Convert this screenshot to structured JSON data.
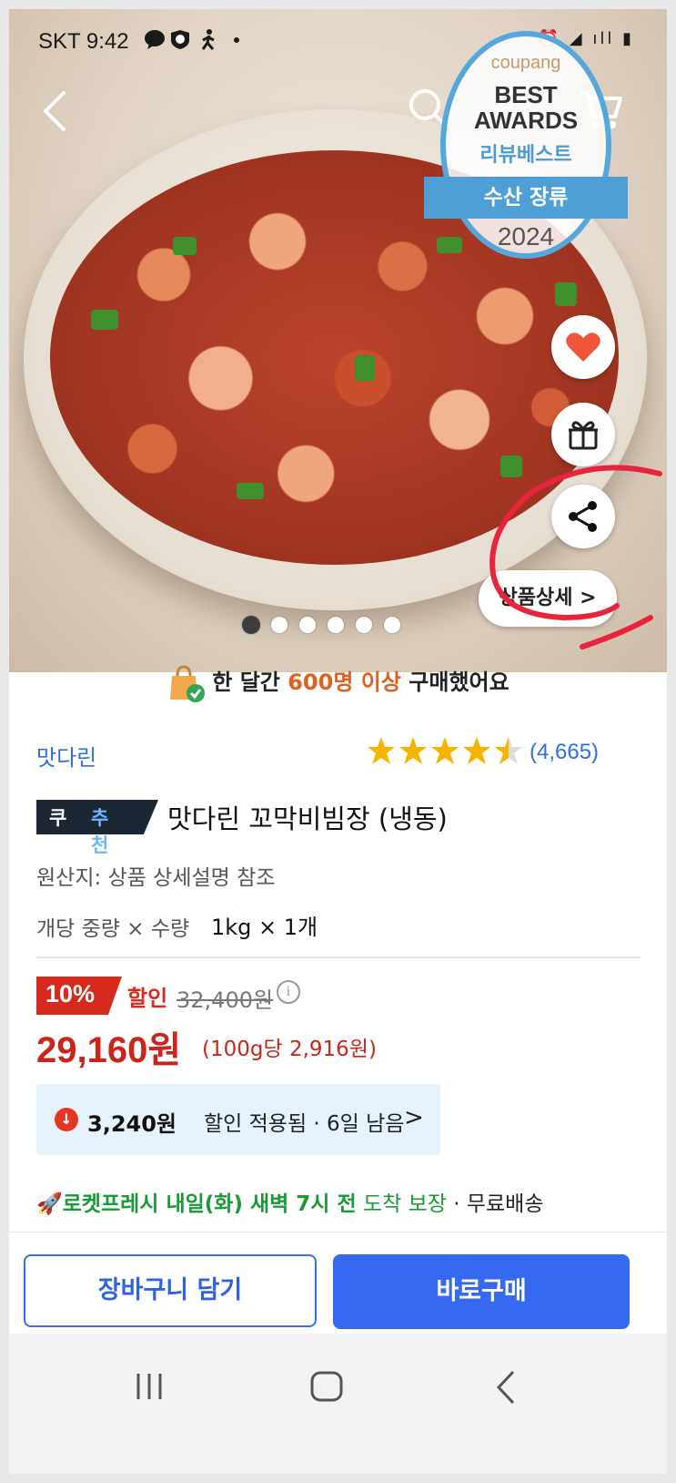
{
  "status_bar": {
    "carrier_time": "SKT 9:42",
    "right_icons": "⏰ ◢ ıll ▮"
  },
  "hero": {
    "award": {
      "brand": "coupang",
      "best_line1": "BEST",
      "best_line2": "AWARDS",
      "sub": "리뷰베스트",
      "category": "수산 장류",
      "year": "2024"
    },
    "detail_button": "상품상세 >",
    "image_count": 6,
    "active_image_index": 0
  },
  "buyers_notice": {
    "prefix": "한 달간 ",
    "highlight": "600명 이상",
    "suffix": " 구매했어요"
  },
  "product": {
    "brand": "맛다린",
    "rating": 4.5,
    "reviews": "(4,665)",
    "badge_part1": "쿠팡",
    "badge_part2": "추천",
    "title": "맛다린 꼬막비빔장 (냉동)",
    "origin": "원산지: 상품 상세설명 참조",
    "weight_label": "개당 중량 × 수량",
    "weight_value": "1kg × 1개"
  },
  "price": {
    "discount_rate": "10%",
    "discount_label": "할인",
    "original_price": "32,400원",
    "info_icon": "i",
    "sale_price": "29,160원",
    "unit_price": "(100g당 2,916원)"
  },
  "coupon": {
    "icon": "↓",
    "amount": "3,240원",
    "text": "할인 적용됨 · 6일 남음",
    "chevron": ">"
  },
  "delivery": {
    "rocket_icon": "🚀",
    "service": "로켓프레시",
    "when": " 내일(화) 새벽 7시 전",
    "guarantee": " 도착 보장",
    "shipping": " · 무료배송"
  },
  "actions": {
    "add_to_cart": "장바구니 담기",
    "buy_now": "바로구매"
  },
  "colors": {
    "accent_blue": "#3469f0",
    "price_red": "#c8261a",
    "rocket_green": "#179b37",
    "annotation_red": "#e8243c"
  }
}
